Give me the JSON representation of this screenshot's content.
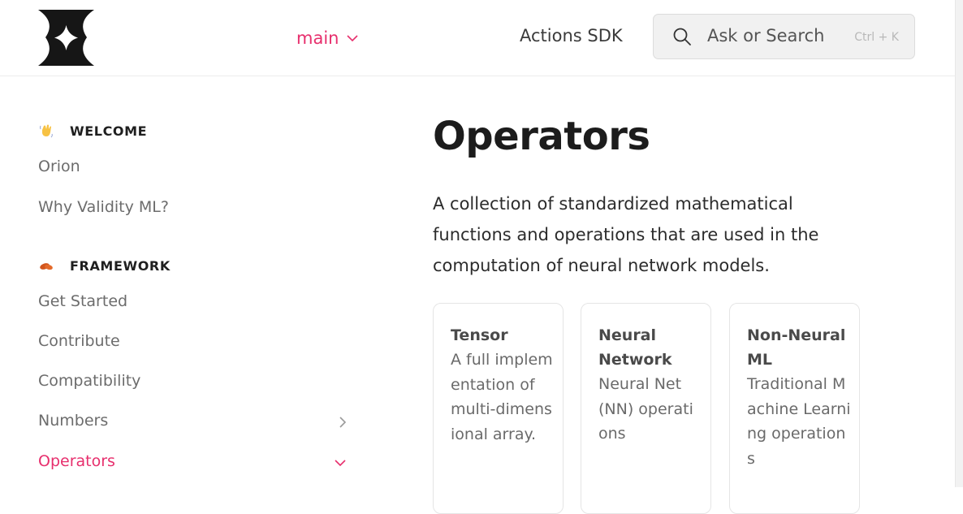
{
  "header": {
    "version": {
      "label": "main"
    },
    "sdk_link": "Actions SDK",
    "search": {
      "placeholder": "Ask or Search",
      "shortcut": "Ctrl + K"
    }
  },
  "sidebar": {
    "sections": [
      {
        "title": "WELCOME",
        "icon": "waving-hand-icon",
        "items": [
          "Orion",
          "Why Validity ML?"
        ]
      },
      {
        "title": "FRAMEWORK",
        "icon": "peanuts-icon",
        "items": [
          "Get Started",
          "Contribute",
          "Compatibility",
          "Numbers",
          "Operators"
        ]
      }
    ],
    "active_item": "Operators"
  },
  "main": {
    "title": "Operators",
    "lead": "A collection of standardized mathematical functions and operations that are used in the computation of neural network models.",
    "cards": [
      {
        "title": "Tensor",
        "description": "A full implementation of multi-dimensional array."
      },
      {
        "title": "Neural Network",
        "description": "Neural Net (NN) operations"
      },
      {
        "title": "Non-Neural ML",
        "description": "Traditional Machine Learning operations"
      }
    ]
  },
  "colors": {
    "accent": "#e72f6d",
    "text": "#2c2c2c",
    "muted": "#6c6c6c"
  }
}
